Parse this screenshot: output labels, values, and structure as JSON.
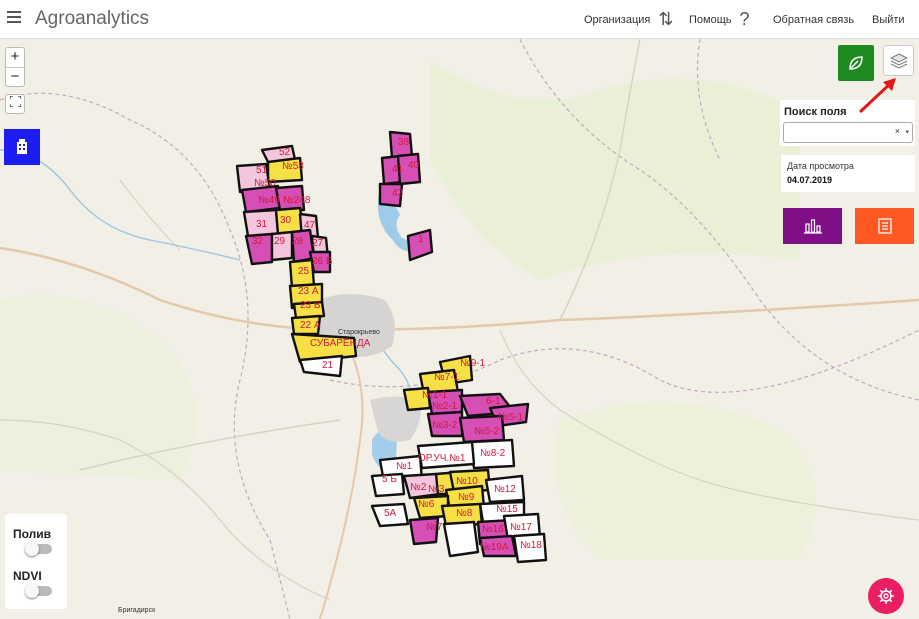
{
  "header": {
    "title": "Agroanalytics",
    "nav": {
      "organization": "Организация",
      "help": "Помощь",
      "help_glyph": "?",
      "feedback": "Обратная связь",
      "exit": "Выйти"
    }
  },
  "map_controls": {
    "zoom_in": "+",
    "zoom_out": "−"
  },
  "search": {
    "label": "Поиск поля",
    "clear_glyph": "×",
    "caret_glyph": "▾"
  },
  "view_date": {
    "label": "Дата просмотра",
    "value": "04.07.2019"
  },
  "layers": {
    "irrigation": "Полив",
    "ndvi": "NDVI"
  },
  "map": {
    "place_names": [
      "Старокрьево",
      "Бригадирск"
    ],
    "field_labels": [
      "52",
      "№53",
      "51",
      "№50",
      "№49",
      "№248",
      "31",
      "30",
      "47",
      "32",
      "29",
      "28",
      "27",
      "26 Б",
      "25",
      "23 А",
      "23 В",
      "22 А",
      "СУБАРЕНДА",
      "21",
      "38",
      "41",
      "40",
      "42",
      "1",
      "№9-1",
      "№7-1",
      "№1-1",
      "№2-1",
      "6-1",
      "№5-1",
      "№3-2",
      "№5-2",
      "№8-2",
      "ОР.УЧ.№1",
      "№1",
      "5 Б",
      "№2",
      "№3",
      "№10",
      "№9",
      "№12",
      "№6",
      "№8",
      "5А",
      "№15",
      "№7",
      "№16",
      "№17",
      "№19А",
      "№18"
    ]
  },
  "colors": {
    "magenta_field": "#d64fb4",
    "yellow_field": "#f6e045",
    "pink_field": "#f3c6dd",
    "accent_blue": "#1d1df2",
    "accent_green": "#1f8a1f",
    "accent_purple": "#7e0f86",
    "accent_orange": "#ff5722",
    "accent_pink": "#e91e63"
  }
}
